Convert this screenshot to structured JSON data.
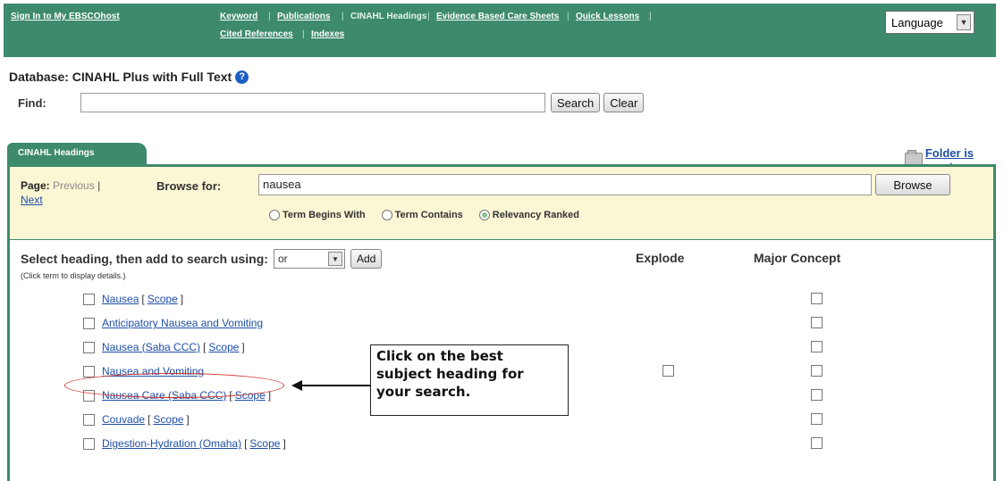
{
  "nav": {
    "sign_in": "Sign In to My EBSCOhost",
    "keyword": "Keyword",
    "publications": "Publications",
    "cinahl_headings": "CINAHL Headings",
    "evidence": "Evidence Based Care Sheets",
    "quick_lessons": "Quick Lessons",
    "cited_references": "Cited References",
    "indexes": "Indexes",
    "language": "Language"
  },
  "database": {
    "label": "Database: CINAHL Plus with Full Text",
    "help_icon": "?"
  },
  "find": {
    "label": "Find:",
    "value": "",
    "search_button": "Search",
    "clear_button": "Clear"
  },
  "tab": {
    "label": "CINAHL Headings"
  },
  "folder": {
    "text": "Folder is empty."
  },
  "browse": {
    "page_label": "Page:",
    "previous": "Previous",
    "separator": "|",
    "next": "Next",
    "browse_for_label": "Browse for:",
    "value": "nausea",
    "button": "Browse",
    "radio_options": [
      "Term Begins With",
      "Term Contains",
      "Relevancy Ranked"
    ],
    "selected_radio": "Relevancy Ranked"
  },
  "select_row": {
    "label": "Select heading, then add to search using:",
    "operator": "or",
    "add_button": "Add",
    "explode_header": "Explode",
    "major_header": "Major Concept",
    "click_note": "(Click term to display details.)"
  },
  "headings": [
    {
      "term": "Nausea",
      "scope": "Scope",
      "explode": false
    },
    {
      "term": "Anticipatory Nausea and Vomiting",
      "scope": null,
      "explode": false
    },
    {
      "term": "Nausea (Saba CCC)",
      "scope": "Scope",
      "explode": false
    },
    {
      "term": "Nausea and Vomiting",
      "scope": null,
      "explode": true
    },
    {
      "term": "Nausea Care (Saba CCC)",
      "scope": "Scope",
      "explode": false
    },
    {
      "term": "Couvade",
      "scope": "Scope",
      "explode": false
    },
    {
      "term": "Digestion-Hydration (Omaha)",
      "scope": "Scope",
      "explode": false
    }
  ],
  "callout": {
    "text": "Click on the best subject heading for your search."
  },
  "colors": {
    "nav_bg": "#3d8a6c",
    "panel_yellow": "#fbf6d4",
    "link": "#1f4fa8",
    "highlight_oval": "#d0322c"
  }
}
